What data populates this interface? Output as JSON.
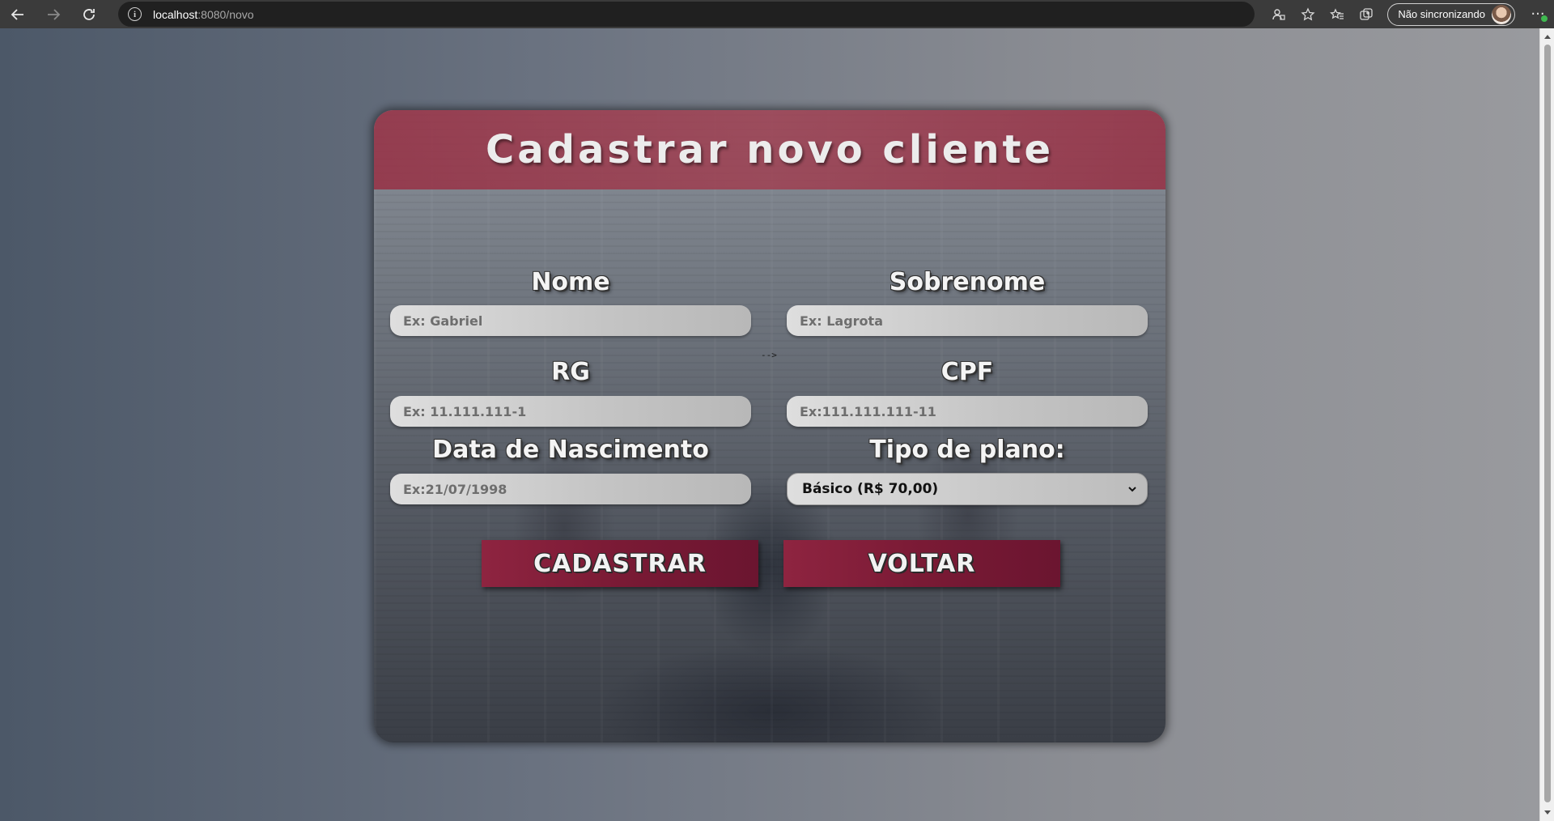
{
  "browser": {
    "url_host": "localhost",
    "url_path": ":8080/novo",
    "sync_label": "Não sincronizando"
  },
  "form": {
    "title": "Cadastrar novo cliente",
    "stray_text": "-->",
    "fields": {
      "nome": {
        "label": "Nome",
        "placeholder": "Ex: Gabriel",
        "value": ""
      },
      "sobrenome": {
        "label": "Sobrenome",
        "placeholder": "Ex: Lagrota",
        "value": ""
      },
      "rg": {
        "label": "RG",
        "placeholder": "Ex: 11.111.111-1",
        "value": ""
      },
      "cpf": {
        "label": "CPF",
        "placeholder": "Ex:111.111.111-11",
        "value": ""
      },
      "nascimento": {
        "label": "Data de Nascimento",
        "placeholder": "Ex:21/07/1998",
        "value": ""
      },
      "plano": {
        "label": "Tipo de plano:",
        "selected": "Básico (R$ 70,00)"
      }
    },
    "buttons": {
      "cadastrar": "CADASTRAR",
      "voltar": "VOLTAR"
    }
  }
}
